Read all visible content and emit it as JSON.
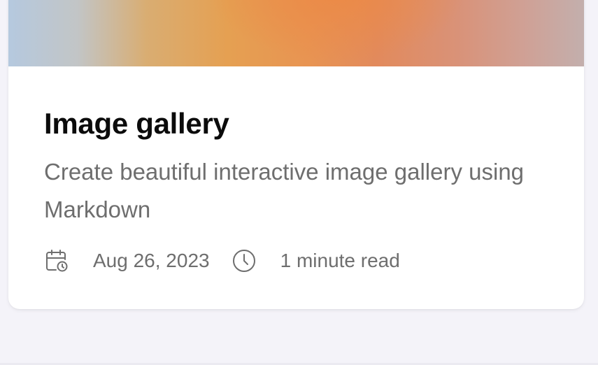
{
  "card": {
    "title": "Image gallery",
    "description": "Create beautiful interactive image gallery using Markdown",
    "date": "Aug 26, 2023",
    "read_time": "1 minute read",
    "icons": {
      "date": "calendar-clock-icon",
      "read_time": "clock-icon"
    }
  }
}
